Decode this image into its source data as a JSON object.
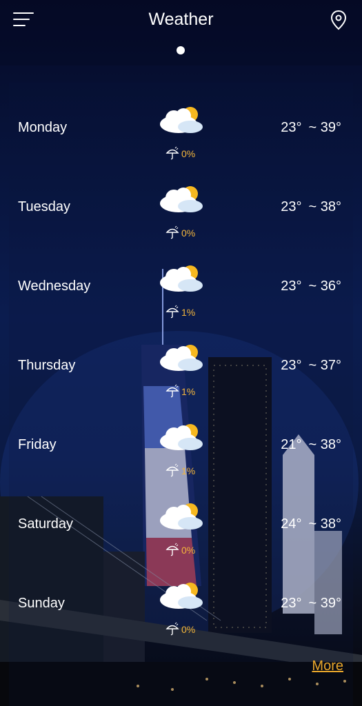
{
  "header": {
    "title": "Weather"
  },
  "forecast": [
    {
      "day": "Monday",
      "precip": "0%",
      "low": "23°",
      "high": "~ 39°"
    },
    {
      "day": "Tuesday",
      "precip": "0%",
      "low": "23°",
      "high": "~ 38°"
    },
    {
      "day": "Wednesday",
      "precip": "1%",
      "low": "23°",
      "high": "~ 36°"
    },
    {
      "day": "Thursday",
      "precip": "1%",
      "low": "23°",
      "high": "~ 37°"
    },
    {
      "day": "Friday",
      "precip": "1%",
      "low": "21°",
      "high": "~ 38°"
    },
    {
      "day": "Saturday",
      "precip": "0%",
      "low": "24°",
      "high": "~ 38°"
    },
    {
      "day": "Sunday",
      "precip": "0%",
      "low": "23°",
      "high": "~ 39°"
    }
  ],
  "more_label": "More",
  "icons": {
    "menu": "menu-icon",
    "location": "location-pin-icon",
    "weather": "partly-cloudy-icon",
    "precip": "umbrella-icon"
  },
  "colors": {
    "accent": "#f4b63c",
    "more": "#e9a72b",
    "text": "#ffffff"
  }
}
